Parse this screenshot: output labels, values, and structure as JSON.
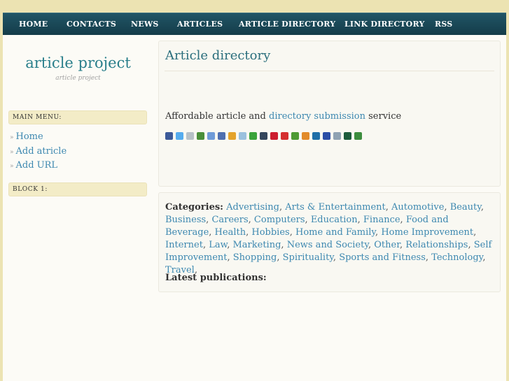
{
  "nav": {
    "items": [
      {
        "label": "HOME"
      },
      {
        "label": "CONTACTS"
      },
      {
        "label": "NEWS"
      },
      {
        "label": "ARTICLES"
      },
      {
        "label": "ARTICLE DIRECTORY"
      },
      {
        "label": "LINK DIRECTORY"
      },
      {
        "label": "RSS"
      }
    ]
  },
  "site": {
    "title": "article project",
    "subtitle": "article project"
  },
  "sidebar": {
    "main_menu_title": "MAIN MENU:",
    "menu": [
      {
        "label": "Home"
      },
      {
        "label": "Add atricle"
      },
      {
        "label": "Add URL"
      }
    ],
    "block1_title": "BLOCK 1:",
    "bullet": "»"
  },
  "main": {
    "title": "Article directory",
    "description_prefix": "Affordable article and ",
    "description_link": "directory submission",
    "description_suffix": " service",
    "share_icons": [
      {
        "icon": "facebook-icon",
        "color": "#3b5998"
      },
      {
        "icon": "twitter-icon",
        "color": "#55acee"
      },
      {
        "icon": "digg-icon",
        "color": "#b7c1c7"
      },
      {
        "icon": "google-buzz-icon",
        "color": "#4a8f3a"
      },
      {
        "icon": "delicious-icon",
        "color": "#6f9bd8"
      },
      {
        "icon": "pencil-icon",
        "color": "#4f6faf"
      },
      {
        "icon": "windows-icon",
        "color": "#e4a32b"
      },
      {
        "icon": "globe-icon",
        "color": "#9bc1de"
      },
      {
        "icon": "talk-icon",
        "color": "#3aa33a"
      },
      {
        "icon": "tumblr-icon",
        "color": "#35465c"
      },
      {
        "icon": "yahoo-icon",
        "color": "#cc1d2e"
      },
      {
        "icon": "yahoo-buzz-icon",
        "color": "#d52f2f"
      },
      {
        "icon": "google-icon",
        "color": "#4e9a33"
      },
      {
        "icon": "msn-icon",
        "color": "#e28b2a"
      },
      {
        "icon": "linkedin-icon",
        "color": "#1f6fa8"
      },
      {
        "icon": "myspace-icon",
        "color": "#2b4ea6"
      },
      {
        "icon": "reddit-icon",
        "color": "#8fa2b3"
      },
      {
        "icon": "technorati-icon",
        "color": "#1c5b3b"
      },
      {
        "icon": "stumbleupon-icon",
        "color": "#3c8d3e"
      }
    ],
    "categories_label": "Categories:",
    "categories": [
      "Advertising",
      "Arts & Entertainment",
      "Automotive",
      "Beauty",
      "Business",
      "Careers",
      "Computers",
      "Education",
      "Finance",
      "Food and Beverage",
      "Health",
      "Hobbies",
      "Home and Family",
      "Home Improvement",
      "Internet",
      "Law",
      "Marketing",
      "News and Society",
      "Other",
      "Relationships",
      "Self Improvement",
      "Shopping",
      "Spirituality",
      "Sports and Fitness",
      "Technology",
      "Travel"
    ],
    "latest_label": "Latest publications:"
  }
}
